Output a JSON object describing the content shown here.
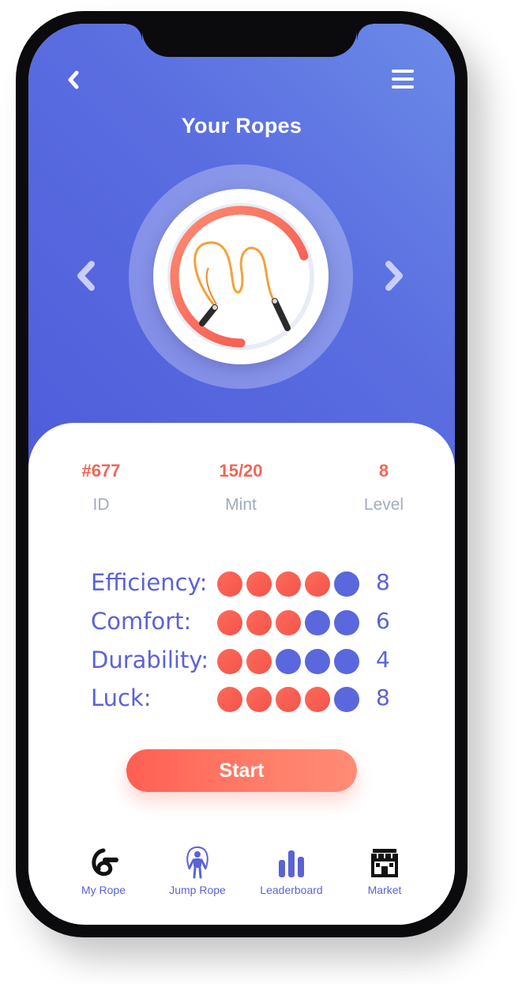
{
  "header": {
    "title": "Your Ropes",
    "back_icon": "chevron-left-icon",
    "menu_icon": "hamburger-menu-icon"
  },
  "carousel": {
    "prev_icon": "chevron-left-icon",
    "next_icon": "chevron-right-icon",
    "item_image": "jump-rope-image",
    "progress_fraction": 0.7
  },
  "rope": {
    "id": {
      "value": "#677",
      "label": "ID"
    },
    "mint": {
      "value": "15/20",
      "label": "Mint"
    },
    "level": {
      "value": "8",
      "label": "Level"
    }
  },
  "stats": [
    {
      "label": "Efficiency:",
      "value": "8",
      "filled": 4,
      "total": 5
    },
    {
      "label": "Comfort:",
      "value": "6",
      "filled": 3,
      "total": 5
    },
    {
      "label": "Durability:",
      "value": "4",
      "filled": 2,
      "total": 5
    },
    {
      "label": "Luck:",
      "value": "8",
      "filled": 4,
      "total": 5
    }
  ],
  "start_button": {
    "label": "Start"
  },
  "nav": [
    {
      "label": "My Rope",
      "icon": "rope-icon"
    },
    {
      "label": "Jump Rope",
      "icon": "jumping-person-icon"
    },
    {
      "label": "Leaderboard",
      "icon": "bar-chart-icon"
    },
    {
      "label": "Market",
      "icon": "storefront-icon"
    }
  ],
  "colors": {
    "accent_red": "#f2544b",
    "accent_blue": "#5a63d6",
    "hero_gradient_start": "#6b8ae8",
    "hero_gradient_end": "#4f5ddb"
  }
}
